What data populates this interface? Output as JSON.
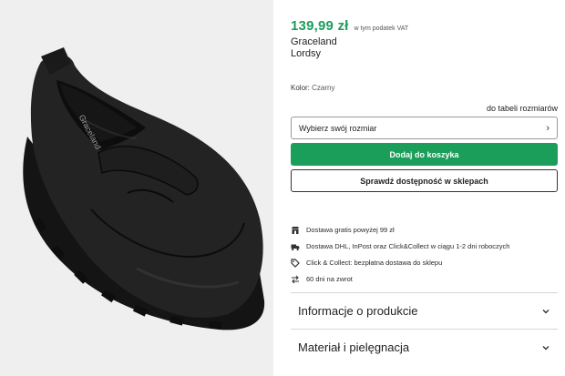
{
  "product": {
    "price": "139,99 zł",
    "vat_note": "w tym podatek VAT",
    "brand": "Graceland",
    "model": "Lordsy",
    "color_label": "Kolor:",
    "color_value": "Czarny",
    "insole_print": "Graceland"
  },
  "size": {
    "table_link": "do tabeli rozmiarów",
    "select_placeholder": "Wybierz swój rozmiar"
  },
  "actions": {
    "add_to_cart": "Dodaj do koszyka",
    "check_store": "Sprawdź dostępność w sklepach"
  },
  "features": [
    {
      "icon": "store-icon",
      "text": "Dostawa gratis powyżej 99 zł"
    },
    {
      "icon": "truck-icon",
      "text": "Dostawa DHL, InPost oraz Click&Collect w ciągu 1-2 dni roboczych"
    },
    {
      "icon": "tag-icon",
      "text": "Click & Collect: bezpłatna dostawa do sklepu"
    },
    {
      "icon": "return-arrows-icon",
      "text": "60 dni na zwrot"
    }
  ],
  "accordions": [
    {
      "title": "Informacje o produkcie"
    },
    {
      "title": "Materiał i pielęgnacja"
    }
  ],
  "colors": {
    "accent_green": "#1a9e5a",
    "gallery_bg": "#efefef",
    "shoe": "#1b1b1b"
  }
}
